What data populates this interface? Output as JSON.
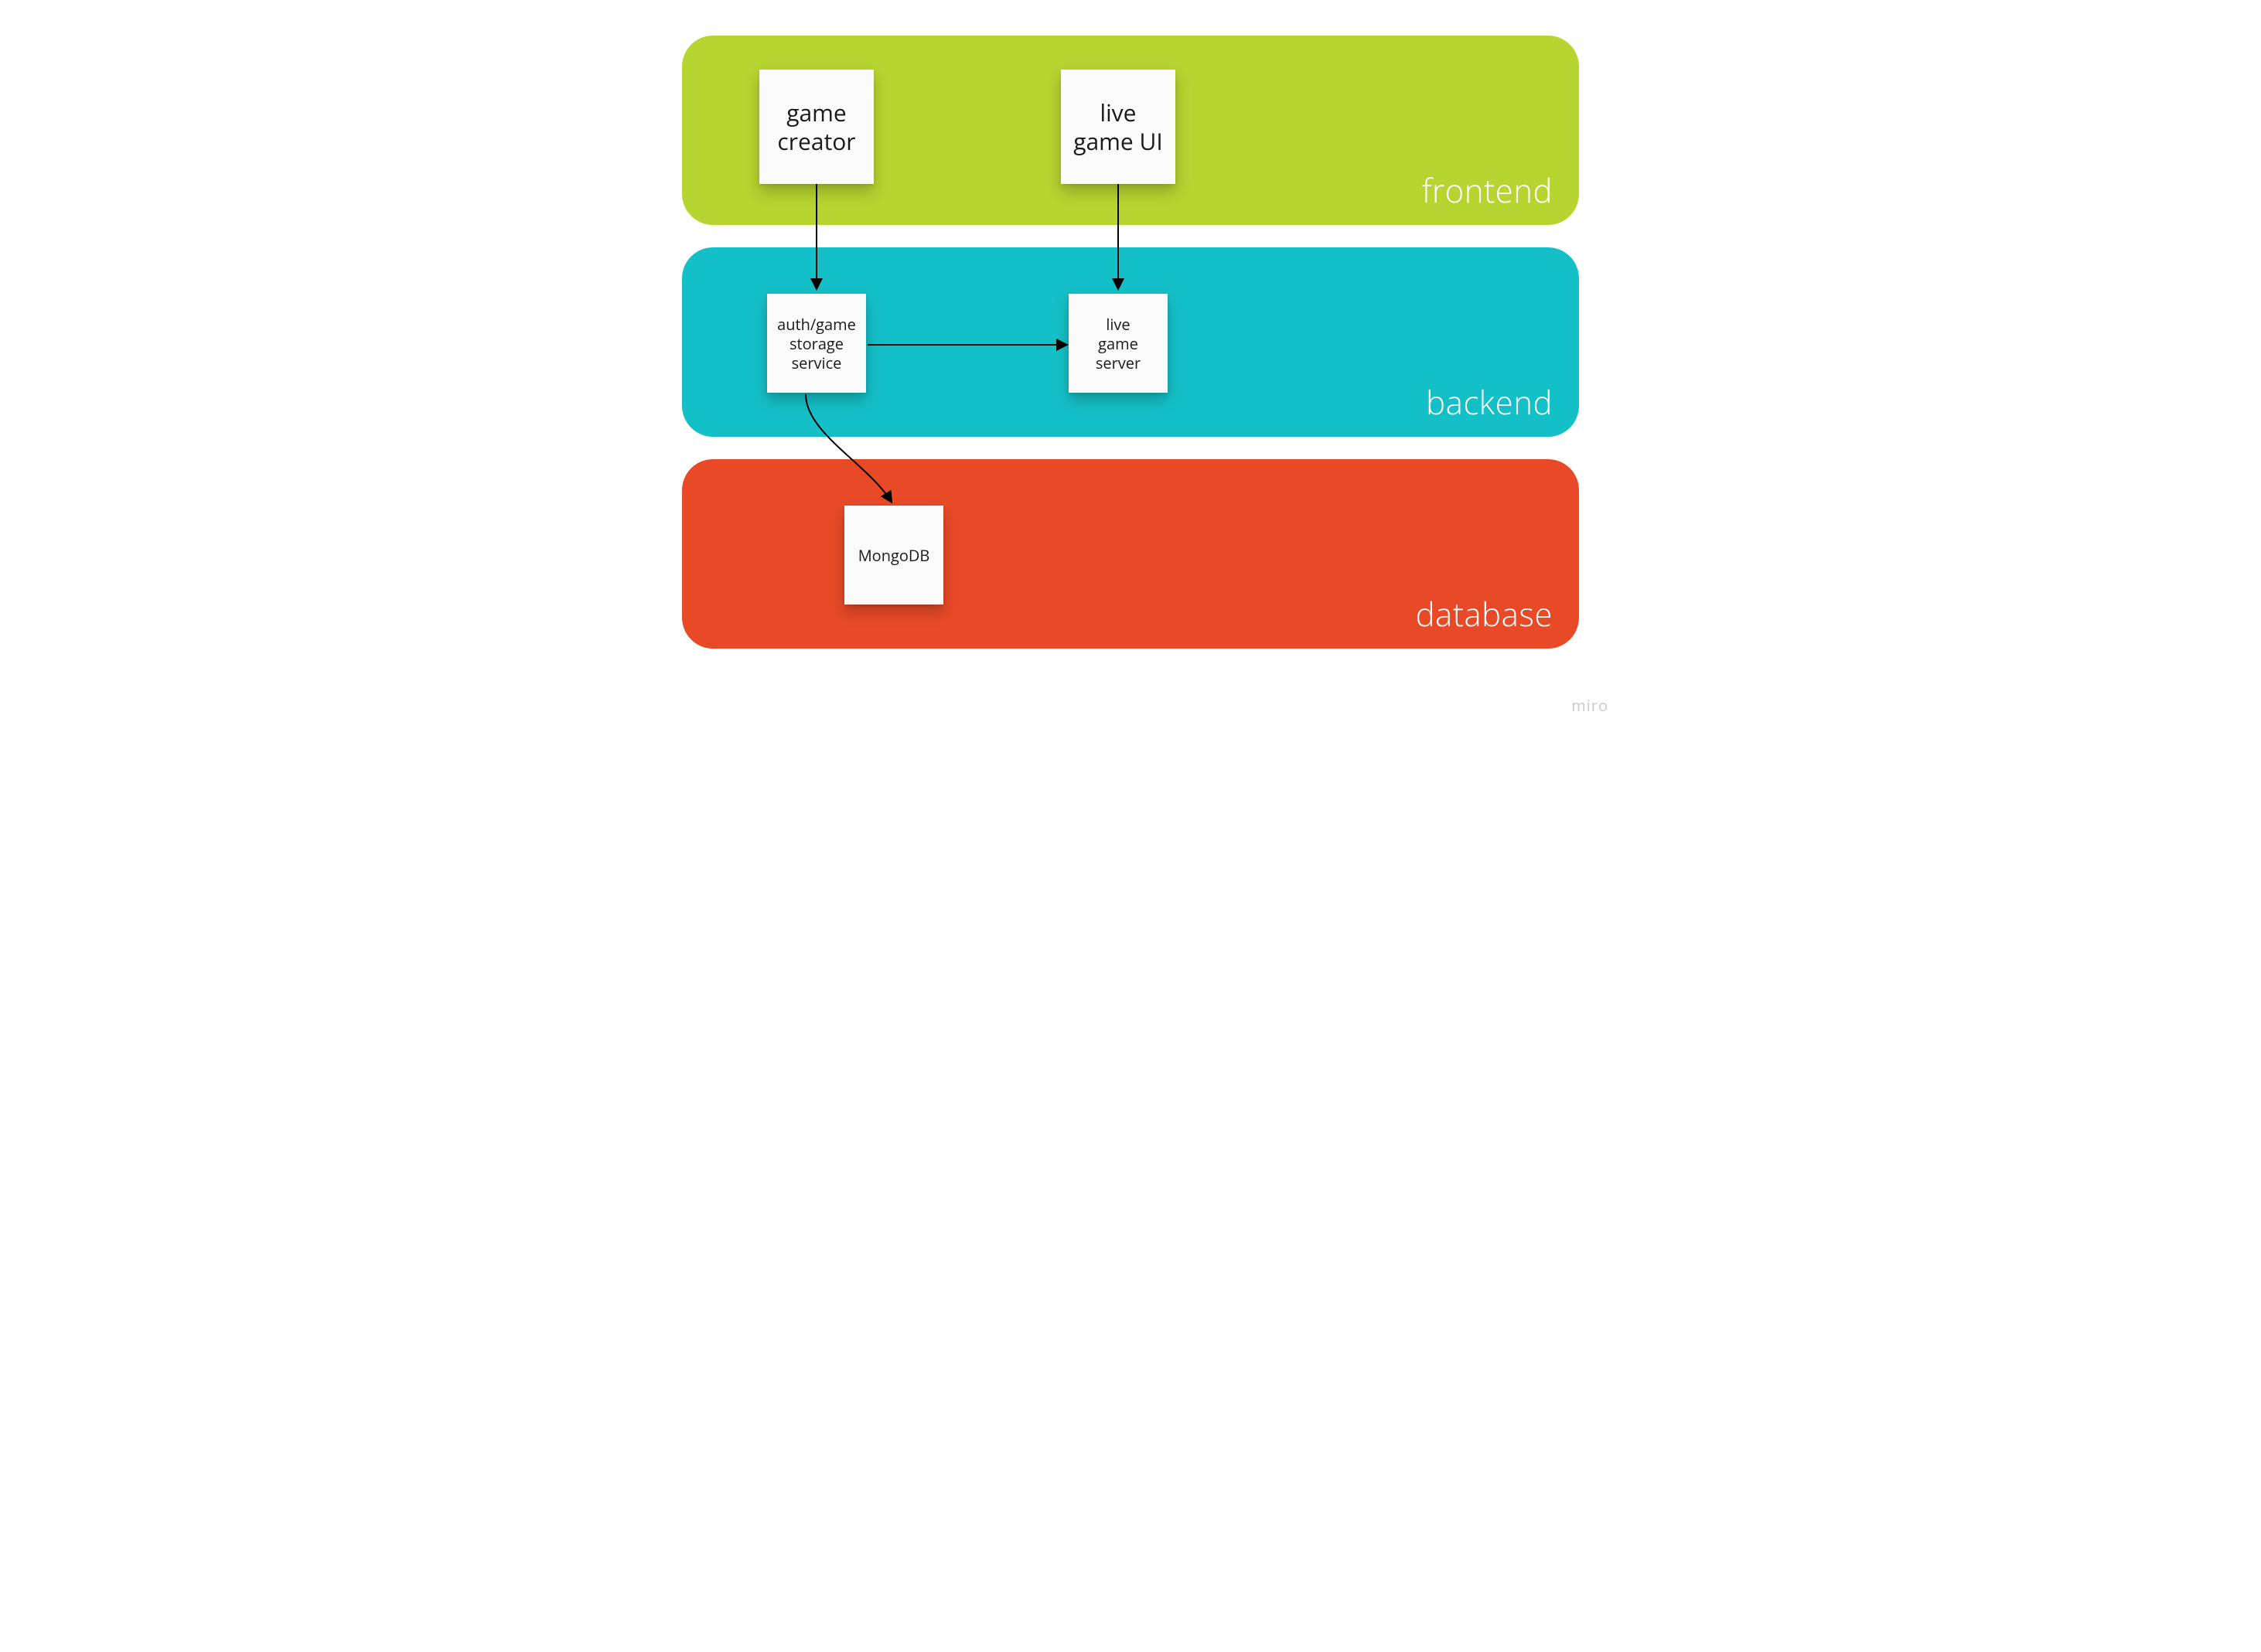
{
  "layers": {
    "frontend": {
      "label": "frontend",
      "color": "#b8d430"
    },
    "backend": {
      "label": "backend",
      "color": "#14c0c7"
    },
    "database": {
      "label": "database",
      "color": "#e84a27"
    }
  },
  "nodes": {
    "game_creator": {
      "label": "game\ncreator"
    },
    "live_game_ui": {
      "label": "live\ngame UI"
    },
    "auth_storage": {
      "label": "auth/game\nstorage\nservice"
    },
    "live_game_server": {
      "label": "live\ngame\nserver"
    },
    "mongodb": {
      "label": "MongoDB"
    }
  },
  "arrows": [
    {
      "from": "game_creator",
      "to": "auth_storage"
    },
    {
      "from": "live_game_ui",
      "to": "live_game_server"
    },
    {
      "from": "auth_storage",
      "to": "live_game_server"
    },
    {
      "from": "auth_storage",
      "to": "mongodb"
    }
  ],
  "watermark": "miro"
}
